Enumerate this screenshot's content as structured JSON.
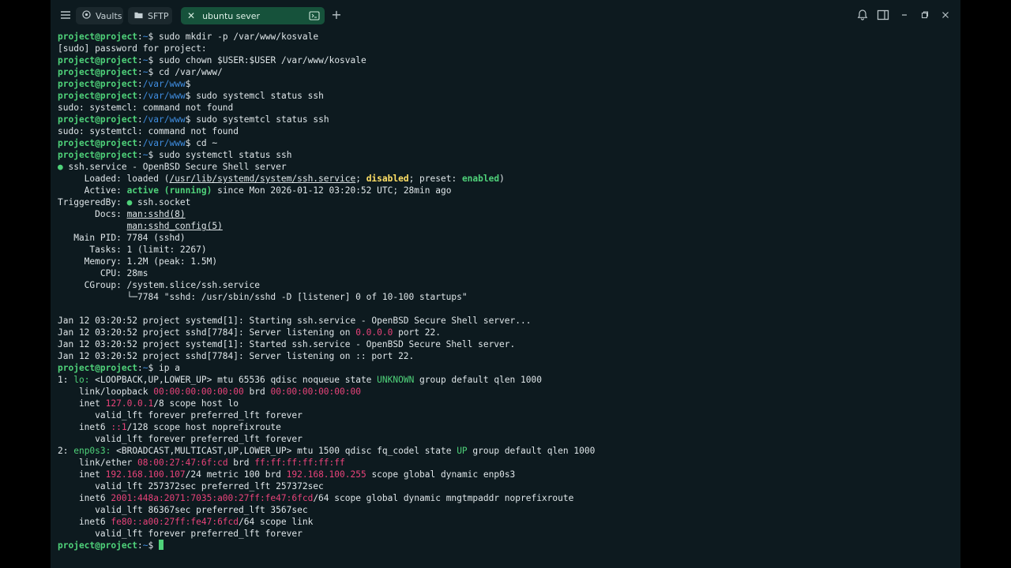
{
  "tabs": [
    {
      "label": "Vaults",
      "icon": "vault-icon"
    },
    {
      "label": "SFTP",
      "icon": "folder-icon"
    },
    {
      "label": "ubuntu sever",
      "icon": "close-icon"
    }
  ],
  "prompt": {
    "user": "project@project",
    "sep": ":",
    "home": "~",
    "www": "/var/www",
    "dollar": "$"
  },
  "lines": {
    "l1": "sudo mkdir -p /var/www/kosvale",
    "l2": "[sudo] password for project:",
    "l3": "sudo chown $USER:$USER /var/www/kosvale",
    "l4": "cd /var/www/",
    "l5": "",
    "l6": "sudo systemcl status ssh",
    "l7": "sudo: systemcl: command not found",
    "l8": "sudo systemtcl status ssh",
    "l9": "sudo: systemtcl: command not found",
    "l10": "cd ~",
    "l11": "sudo systemctl status ssh",
    "l12a": "● ",
    "l12b": "ssh.service - OpenBSD Secure Shell server",
    "l13a": "     Loaded: loaded (",
    "l13b": "/usr/lib/systemd/system/ssh.service",
    "l13c": "; ",
    "l13d": "disabled",
    "l13e": "; preset: ",
    "l13f": "enabled",
    "l13g": ")",
    "l14a": "     Active: ",
    "l14b": "active (running)",
    "l14c": " since Mon 2026-01-12 03:20:52 UTC; 28min ago",
    "l15a": "TriggeredBy: ",
    "l15b": "●",
    "l15c": " ssh.socket",
    "l16a": "       Docs: ",
    "l16b": "man:sshd(8)",
    "l17a": "             ",
    "l17b": "man:sshd_config(5)",
    "l18": "   Main PID: 7784 (sshd)",
    "l19": "      Tasks: 1 (limit: 2267)",
    "l20": "     Memory: 1.2M (peak: 1.5M)",
    "l21": "        CPU: 28ms",
    "l22": "     CGroup: /system.slice/ssh.service",
    "l23": "             └─7784 \"sshd: /usr/sbin/sshd -D [listener] 0 of 10-100 startups\"",
    "l24": "",
    "l25": "Jan 12 03:20:52 project systemd[1]: Starting ssh.service - OpenBSD Secure Shell server...",
    "l26a": "Jan 12 03:20:52 project sshd[7784]: Server listening on ",
    "l26b": "0.0.0.0",
    "l26c": " port 22.",
    "l27": "Jan 12 03:20:52 project systemd[1]: Started ssh.service - OpenBSD Secure Shell server.",
    "l28": "Jan 12 03:20:52 project sshd[7784]: Server listening on :: port 22.",
    "l29": "ip a",
    "l30a": "1: ",
    "l30b": "lo:",
    "l30c": " <LOOPBACK,UP,LOWER_UP> mtu 65536 qdisc noqueue state ",
    "l30d": "UNKNOWN",
    "l30e": " group default qlen 1000",
    "l31a": "    link/loopback ",
    "l31b": "00:00:00:00:00:00",
    "l31c": " brd ",
    "l31d": "00:00:00:00:00:00",
    "l32a": "    inet ",
    "l32b": "127.0.0.1",
    "l32c": "/8 scope host lo",
    "l33": "       valid_lft forever preferred_lft forever",
    "l34a": "    inet6 ",
    "l34b": "::1",
    "l34c": "/128 scope host noprefixroute",
    "l35": "       valid_lft forever preferred_lft forever",
    "l36a": "2: ",
    "l36b": "enp0s3:",
    "l36c": " <BROADCAST,MULTICAST,UP,LOWER_UP> mtu 1500 qdisc fq_codel state ",
    "l36d": "UP",
    "l36e": " group default qlen 1000",
    "l37a": "    link/ether ",
    "l37b": "08:00:27:47:6f:cd",
    "l37c": " brd ",
    "l37d": "ff:ff:ff:ff:ff:ff",
    "l38a": "    inet ",
    "l38b": "192.168.100.107",
    "l38c": "/24 metric 100 brd ",
    "l38d": "192.168.100.255",
    "l38e": " scope global dynamic enp0s3",
    "l39": "       valid_lft 257372sec preferred_lft 257372sec",
    "l40a": "    inet6 ",
    "l40b": "2001:448a:2071:7035:a00:27ff:fe47:6fcd",
    "l40c": "/64 scope global dynamic mngtmpaddr noprefixroute",
    "l41": "       valid_lft 86367sec preferred_lft 3567sec",
    "l42a": "    inet6 ",
    "l42b": "fe80::a00:27ff:fe47:6fcd",
    "l42c": "/64 scope link",
    "l43": "       valid_lft forever preferred_lft forever"
  },
  "colors": {
    "accent": "#4fd27a",
    "path": "#3f8de0",
    "addr": "#e8437a",
    "warn": "#ffe066",
    "bg": "#0d1a1f",
    "tab_active": "#16523b"
  }
}
